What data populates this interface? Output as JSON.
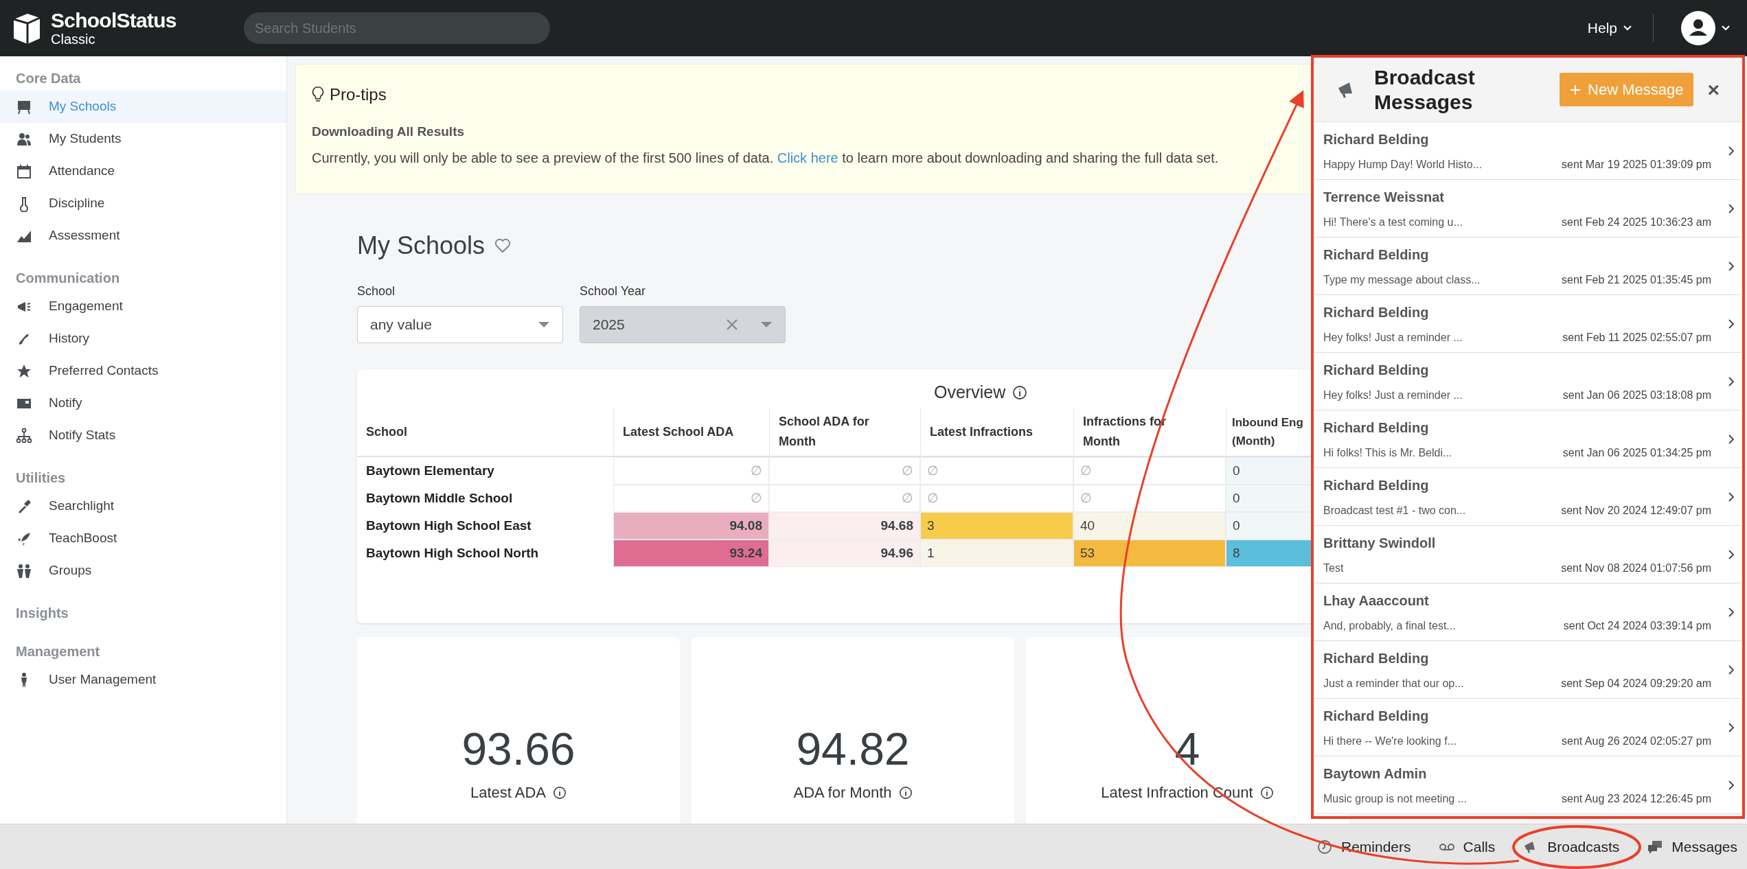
{
  "header": {
    "logo": {
      "name": "SchoolStatus",
      "subtitle": "Classic"
    },
    "search": {
      "placeholder": "Search Students"
    },
    "help": "Help"
  },
  "sidebar": {
    "sections": [
      {
        "title": "Core Data",
        "items": [
          {
            "label": "My Schools",
            "selected": true
          },
          {
            "label": "My Students",
            "selected": false
          },
          {
            "label": "Attendance",
            "selected": false
          },
          {
            "label": "Discipline",
            "selected": false
          },
          {
            "label": "Assessment",
            "selected": false
          }
        ]
      },
      {
        "title": "Communication",
        "items": [
          {
            "label": "Engagement",
            "selected": false
          },
          {
            "label": "History",
            "selected": false
          },
          {
            "label": "Preferred Contacts",
            "selected": false
          },
          {
            "label": "Notify",
            "selected": false
          },
          {
            "label": "Notify Stats",
            "selected": false
          }
        ]
      },
      {
        "title": "Utilities",
        "items": [
          {
            "label": "Searchlight",
            "selected": false
          },
          {
            "label": "TeachBoost",
            "selected": false
          },
          {
            "label": "Groups",
            "selected": false
          }
        ]
      },
      {
        "title": "Insights"
      },
      {
        "title": "Management",
        "items": [
          {
            "label": "User Management",
            "selected": false
          }
        ]
      }
    ]
  },
  "pro_tips": {
    "title": "Pro-tips",
    "heading": "Downloading All Results",
    "text_before": "Currently, you will only be able to see a preview of the first 500 lines of data.",
    "link": "Click here",
    "text_after": "to learn more about downloading and sharing the full data set."
  },
  "page_title": "My Schools",
  "filters": [
    {
      "label": "School",
      "value": "any value",
      "disabled": false,
      "clearable": false
    },
    {
      "label": "School Year",
      "value": "2025",
      "disabled": true,
      "clearable": true
    }
  ],
  "overview": {
    "title": "Overview",
    "columns": [
      "School",
      "Latest School ADA",
      "School ADA for Month",
      "Latest Infractions",
      "Infractions for Month",
      "Inbound Eng (Month)"
    ],
    "rows": [
      [
        {
          "text": "Baytown Elementary"
        },
        {
          "text": "∅"
        },
        {
          "text": "∅"
        },
        {
          "text": "∅"
        },
        {
          "text": "∅"
        },
        {
          "text": "0",
          "color": "#f1f7f8"
        }
      ],
      [
        {
          "text": "Baytown Middle School"
        },
        {
          "text": "∅"
        },
        {
          "text": "∅"
        },
        {
          "text": "∅"
        },
        {
          "text": "∅"
        },
        {
          "text": "0",
          "color": "#f1f7f8"
        }
      ],
      [
        {
          "text": "Baytown High School East"
        },
        {
          "text": "94.08",
          "color": "#e8adbe"
        },
        {
          "text": "94.68",
          "color": "#faeeee"
        },
        {
          "text": "3",
          "color": "#f6cc4a"
        },
        {
          "text": "40",
          "color": "#f8f4e8"
        },
        {
          "text": "0",
          "color": "#f1f7f8"
        }
      ],
      [
        {
          "text": "Baytown High School North"
        },
        {
          "text": "93.24",
          "color": "#de6d91"
        },
        {
          "text": "94.96",
          "color": "#faeeee"
        },
        {
          "text": "1",
          "color": "#f8f4e8"
        },
        {
          "text": "53",
          "color": "#f3b941"
        },
        {
          "text": "8",
          "color": "#5bbfdc"
        }
      ]
    ]
  },
  "stat_cards": [
    {
      "value": "93.66",
      "label": "Latest ADA"
    },
    {
      "value": "94.82",
      "label": "ADA for Month"
    },
    {
      "value": "4",
      "label": "Latest Infraction Count"
    }
  ],
  "broadcast_panel": {
    "title": "Broadcast Messages",
    "new_button": "New Message",
    "close": "×",
    "messages": [
      {
        "sender": "Richard Belding",
        "preview": "Happy Hump Day! World Histo...",
        "sent": "sent Mar 19 2025 01:39:09 pm"
      },
      {
        "sender": "Terrence Weissnat",
        "preview": "Hi! There's a test coming u...",
        "sent": "sent Feb 24 2025 10:36:23 am"
      },
      {
        "sender": "Richard Belding",
        "preview": "Type my message about class...",
        "sent": "sent Feb 21 2025 01:35:45 pm"
      },
      {
        "sender": "Richard Belding",
        "preview": "Hey folks! Just a reminder ...",
        "sent": "sent Feb 11 2025 02:55:07 pm"
      },
      {
        "sender": "Richard Belding",
        "preview": "Hey folks! Just a reminder ...",
        "sent": "sent Jan 06 2025 03:18:08 pm"
      },
      {
        "sender": "Richard Belding",
        "preview": "Hi folks! This is Mr. Beldi...",
        "sent": "sent Jan 06 2025 01:34:25 pm"
      },
      {
        "sender": "Richard Belding",
        "preview": "Broadcast test #1 - two con...",
        "sent": "sent Nov 20 2024 12:49:07 pm"
      },
      {
        "sender": "Brittany Swindoll",
        "preview": "Test",
        "sent": "sent Nov 08 2024 01:07:56 pm"
      },
      {
        "sender": "Lhay Aaaccount",
        "preview": "And, probably, a final test...",
        "sent": "sent Oct 24 2024 03:39:14 pm"
      },
      {
        "sender": "Richard Belding",
        "preview": "Just a reminder that our op...",
        "sent": "sent Sep 04 2024 09:29:20 am"
      },
      {
        "sender": "Richard Belding",
        "preview": "Hi there -- We're looking f...",
        "sent": "sent Aug 26 2024 02:05:27 pm"
      },
      {
        "sender": "Baytown Admin",
        "preview": "Music group is not meeting ...",
        "sent": "sent Aug 23 2024 12:26:45 pm"
      }
    ]
  },
  "bottom_bar": [
    {
      "label": "Reminders"
    },
    {
      "label": "Calls"
    },
    {
      "label": "Broadcasts"
    },
    {
      "label": "Messages"
    }
  ]
}
